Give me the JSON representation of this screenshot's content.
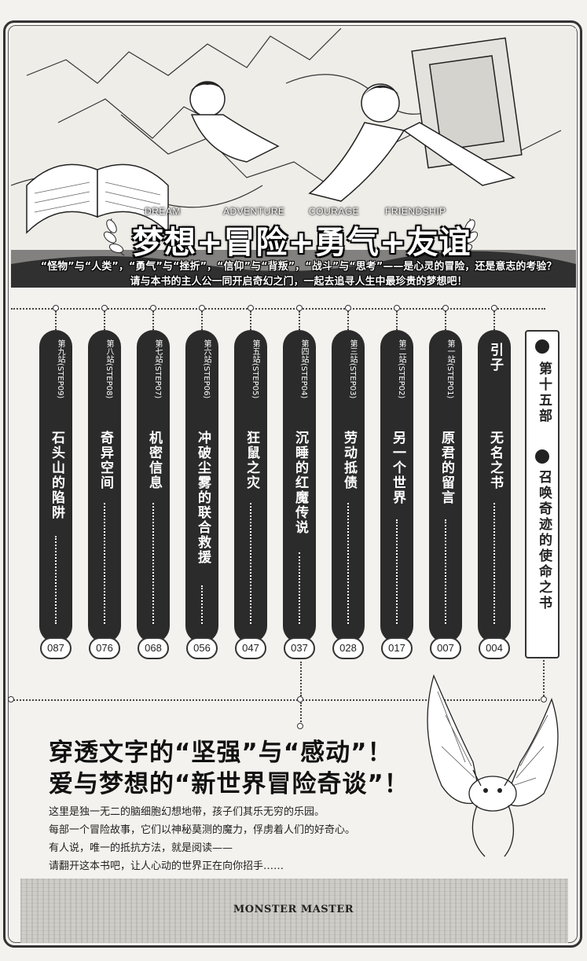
{
  "banner": {
    "english": [
      "DREAM",
      "ADVENTURE",
      "COURAGE",
      "FRIENDSHIP"
    ],
    "title": "梦想+冒险+勇气+友谊"
  },
  "tagline": {
    "line1": "“怪物”与“人类”，“勇气”与“挫折”，“信仰”与“背叛”，“战斗”与“思考”——是心灵的冒险，还是意志的考验？",
    "line2": "请与本书的主人公一同开启奇幻之门，一起去追寻人生中最珍贵的梦想吧！"
  },
  "part": {
    "number": "第十五部",
    "title": "召唤奇迹的使命之书"
  },
  "chapters": [
    {
      "step": "第九站(STEP09)",
      "title": "石头山的陷阱",
      "page": "087"
    },
    {
      "step": "第八站(STEP08)",
      "title": "奇异空间",
      "page": "076"
    },
    {
      "step": "第七站(STEP07)",
      "title": "机密信息",
      "page": "068"
    },
    {
      "step": "第六站(STEP06)",
      "title": "冲破尘雾的联合救援",
      "page": "056"
    },
    {
      "step": "第五站(STEP05)",
      "title": "狂鼠之灾",
      "page": "047"
    },
    {
      "step": "第四站(STEP04)",
      "title": "沉睡的红魔传说",
      "page": "037"
    },
    {
      "step": "第三站(STEP03)",
      "title": "劳动抵债",
      "page": "028"
    },
    {
      "step": "第二站(STEP02)",
      "title": "另一个世界",
      "page": "017"
    },
    {
      "step": "第一站(STEP01)",
      "title": "原君的留言",
      "page": "007"
    },
    {
      "step": "",
      "title": "引子",
      "subtitle": "无名之书",
      "page": "004"
    }
  ],
  "headline": {
    "line1": "穿透文字的“坚强”与“感动”！",
    "line2": "爱与梦想的“新世界冒险奇谈”！"
  },
  "body": [
    "这里是独一无二的脑细胞幻想地带，孩子们其乐无穷的乐园。",
    "每部一个冒险故事，它们以神秘莫测的魔力，俘虏着人们的好奇心。",
    "有人说，唯一的抵抗方法，就是阅读——",
    "请翻开这本书吧，让人心动的世界正在向你招手……"
  ],
  "footer": {
    "brand": "MONSTER MASTER"
  },
  "icons": [
    "book-illustration",
    "creature-illustration",
    "laurel-icon"
  ]
}
